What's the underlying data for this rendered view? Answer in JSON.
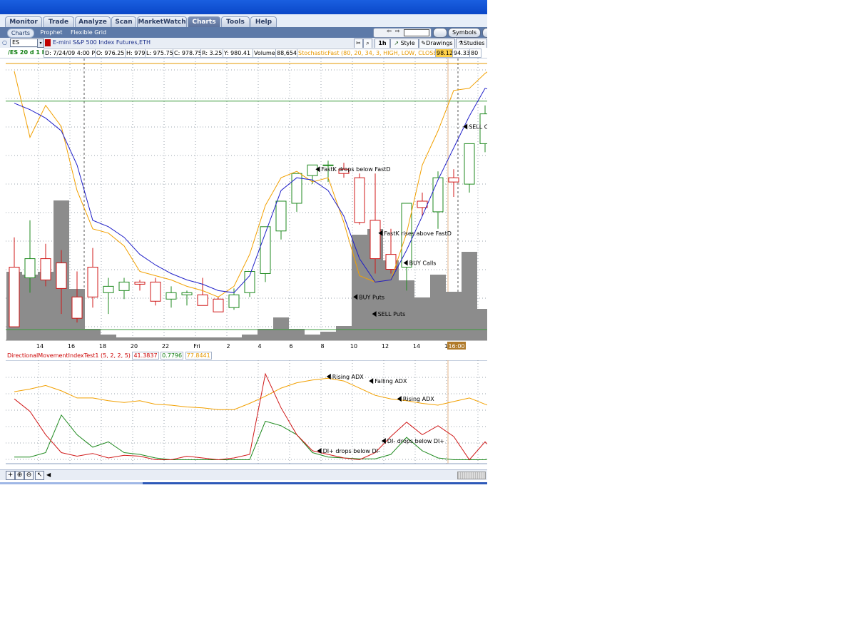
{
  "nav": {
    "tabs": [
      {
        "label": "Monitor",
        "active": false
      },
      {
        "label": "Trade",
        "active": false
      },
      {
        "label": "Analyze",
        "active": false
      },
      {
        "label": "Scan",
        "active": false
      },
      {
        "label": "MarketWatch",
        "active": false
      },
      {
        "label": "Charts",
        "active": true
      },
      {
        "label": "Tools",
        "active": false
      },
      {
        "label": "Help",
        "active": false
      }
    ]
  },
  "subnav": {
    "items": [
      {
        "label": "Charts",
        "active": true
      },
      {
        "label": "Prophet",
        "active": false
      },
      {
        "label": "Flexible Grid",
        "active": false
      }
    ],
    "symbols_label": "Symbols"
  },
  "toolbar": {
    "symbol": "ES",
    "description": "E-mini S&P 500 Index Futures,ETH",
    "aggregation": "1h",
    "style_label": "Style",
    "drawings_label": "Drawings",
    "studies_label": "Studies"
  },
  "quote": {
    "symbol_period": "/ES 20 d 1 h",
    "date": "D: 7/24/09 4:00 PM",
    "open": "O: 976.25",
    "high": "H: 979",
    "low": "L: 975.75",
    "close": "C: 978.75",
    "range": "R: 3.25",
    "y": "Y: 980.41",
    "volume_label": "Volume",
    "volume": "88,654",
    "study": "StochasticFast (80, 20, 34, 3, HIGH, LOW, CLOSE, 1)",
    "study_val1": "98.12",
    "study_val2": "94.33",
    "study_val3": "80"
  },
  "chart_data": {
    "type": "candlestick",
    "x_tick_labels": [
      "14",
      "16",
      "18",
      "20",
      "22",
      "Fri",
      "2",
      "4",
      "6",
      "8",
      "10",
      "12",
      "14",
      "16"
    ],
    "cursor_time_label": "16:00",
    "candles": [
      {
        "o": 34,
        "h": 48,
        "l": 6,
        "c": 6
      },
      {
        "o": 29,
        "h": 56,
        "l": 22,
        "c": 38
      },
      {
        "o": 38,
        "h": 45,
        "l": 25,
        "c": 28
      },
      {
        "o": 36,
        "h": 42,
        "l": 12,
        "c": 24
      },
      {
        "o": 20,
        "h": 32,
        "l": 8,
        "c": 10
      },
      {
        "o": 34,
        "h": 43,
        "l": 15,
        "c": 20
      },
      {
        "o": 22,
        "h": 29,
        "l": 12,
        "c": 25
      },
      {
        "o": 23,
        "h": 29,
        "l": 19,
        "c": 27
      },
      {
        "o": 27,
        "h": 28,
        "l": 23,
        "c": 26
      },
      {
        "o": 27,
        "h": 29,
        "l": 16,
        "c": 18
      },
      {
        "o": 19,
        "h": 25,
        "l": 15,
        "c": 22
      },
      {
        "o": 21,
        "h": 23,
        "l": 16,
        "c": 22
      },
      {
        "o": 21,
        "h": 29,
        "l": 20,
        "c": 16
      },
      {
        "o": 19,
        "h": 20,
        "l": 13,
        "c": 13
      },
      {
        "o": 15,
        "h": 24,
        "l": 14,
        "c": 21
      },
      {
        "o": 22,
        "h": 30,
        "l": 20,
        "c": 32
      },
      {
        "o": 31,
        "h": 48,
        "l": 27,
        "c": 53
      },
      {
        "o": 51,
        "h": 57,
        "l": 47,
        "c": 65
      },
      {
        "o": 64,
        "h": 73,
        "l": 60,
        "c": 78
      },
      {
        "o": 77,
        "h": 79,
        "l": 73,
        "c": 82
      },
      {
        "o": 82,
        "h": 84,
        "l": 74,
        "c": 82
      },
      {
        "o": 80,
        "h": 83,
        "l": 76,
        "c": 78
      },
      {
        "o": 76,
        "h": 78,
        "l": 54,
        "c": 55
      },
      {
        "o": 56,
        "h": 78,
        "l": 31,
        "c": 38
      },
      {
        "o": 40,
        "h": 52,
        "l": 31,
        "c": 33
      },
      {
        "o": 34,
        "h": 47,
        "l": 23,
        "c": 64
      },
      {
        "o": 65,
        "h": 69,
        "l": 58,
        "c": 62
      },
      {
        "o": 60,
        "h": 79,
        "l": 52,
        "c": 76
      },
      {
        "o": 76,
        "h": 80,
        "l": 67,
        "c": 74
      },
      {
        "o": 73,
        "h": 89,
        "l": 69,
        "c": 92
      },
      {
        "o": 92,
        "h": 110,
        "l": 88,
        "c": 106
      },
      {
        "o": 100,
        "h": 104,
        "l": 84,
        "c": 87
      },
      {
        "o": 89,
        "h": 91,
        "l": 85,
        "c": 89
      }
    ],
    "volume": [
      24,
      23,
      24,
      49,
      18,
      4,
      2,
      1,
      1,
      1,
      1,
      1,
      1,
      1,
      1,
      2,
      4,
      8,
      4,
      2,
      3,
      5,
      37,
      39,
      28,
      21,
      15,
      23,
      17,
      31,
      11,
      1,
      0
    ],
    "stoch_fastk": [
      126,
      95,
      110,
      100,
      70,
      52,
      50,
      44,
      32,
      30,
      28,
      25,
      23,
      20,
      25,
      40,
      63,
      76,
      79,
      74,
      76,
      55,
      30,
      27,
      28,
      50,
      82,
      98,
      117,
      118,
      125,
      130,
      113
    ],
    "stoch_fastd": [
      111,
      108,
      104,
      98,
      82,
      56,
      53,
      48,
      40,
      35,
      31,
      28,
      26,
      23,
      22,
      30,
      50,
      70,
      76,
      75,
      70,
      58,
      38,
      27,
      28,
      42,
      58,
      75,
      90,
      105,
      118,
      116,
      110
    ],
    "annotations": [
      {
        "text": "FastK drops below FastD",
        "i": 19.2,
        "v": 80
      },
      {
        "text": "FastK rises above FastD",
        "i": 23.2,
        "v": 50
      },
      {
        "text": "BUY Calls",
        "i": 24.8,
        "v": 36
      },
      {
        "text": "BUY Puts",
        "i": 21.6,
        "v": 20
      },
      {
        "text": "SELL Puts",
        "i": 22.8,
        "v": 12
      },
      {
        "text": "SELL Calls",
        "i": 28.6,
        "v": 100
      }
    ],
    "dmi": {
      "title": "DirectionalMovementIndexTest1 (5, 2, 2, 5)",
      "val_adx": "41.3837",
      "val_diplus": "0.7796",
      "val_diminus": "77.8441",
      "adx": [
        78,
        81,
        85,
        79,
        71,
        71,
        68,
        66,
        68,
        64,
        63,
        61,
        60,
        58,
        58,
        65,
        73,
        82,
        88,
        91,
        93,
        90,
        82,
        74,
        70,
        68,
        65,
        63,
        67,
        71,
        64,
        58
      ],
      "di_plus": [
        5,
        5,
        10,
        52,
        30,
        16,
        22,
        10,
        8,
        4,
        2,
        2,
        2,
        2,
        2,
        2,
        45,
        40,
        30,
        10,
        5,
        4,
        3,
        3,
        8,
        27,
        12,
        4,
        2,
        2,
        2,
        6,
        20
      ],
      "di_minus": [
        70,
        56,
        30,
        10,
        6,
        9,
        4,
        7,
        6,
        2,
        2,
        6,
        4,
        2,
        4,
        8,
        98,
        60,
        30,
        12,
        8,
        4,
        2,
        10,
        28,
        44,
        30,
        40,
        28,
        2,
        22,
        5
      ],
      "annotations": [
        {
          "text": "Rising ADX",
          "i": 19.9,
          "v": 95
        },
        {
          "text": "Falling ADX",
          "i": 22.6,
          "v": 90
        },
        {
          "text": "Rising ADX",
          "i": 24.4,
          "v": 70
        },
        {
          "text": "DI+ drops below DI-",
          "i": 19.3,
          "v": 12
        },
        {
          "text": "DI- drops below DI+",
          "i": 23.4,
          "v": 23
        }
      ]
    }
  }
}
